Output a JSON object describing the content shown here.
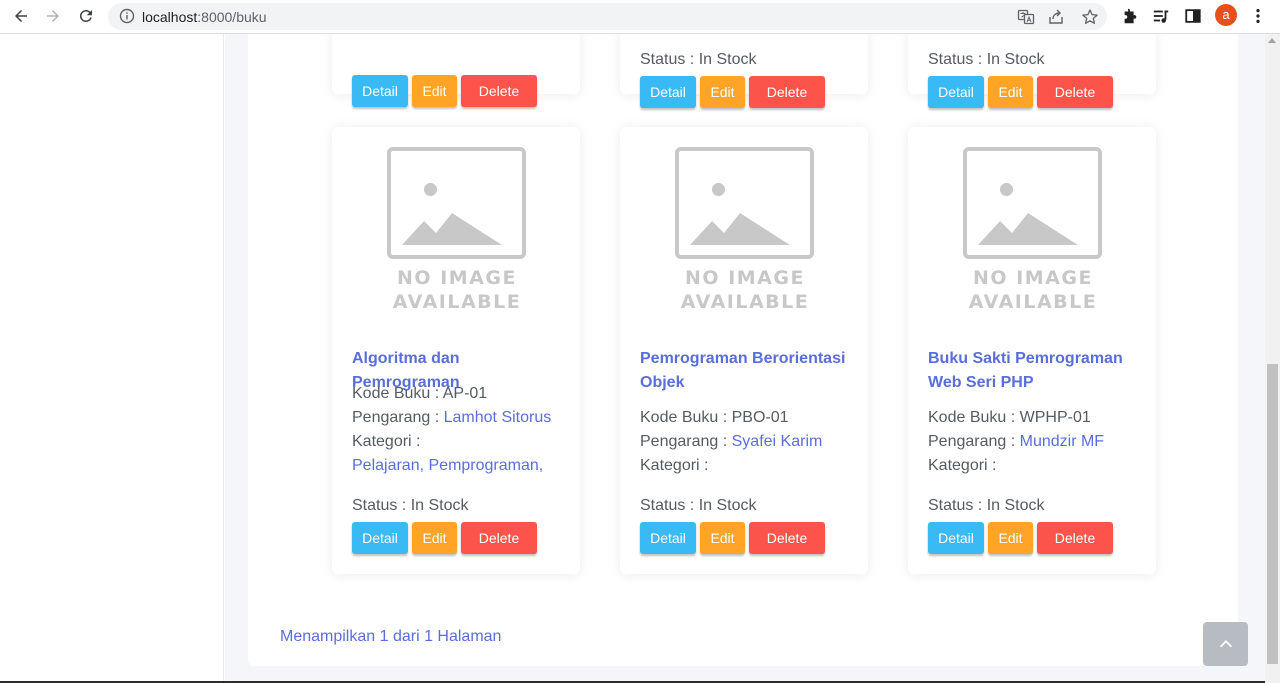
{
  "browser": {
    "url_host": "localhost",
    "url_path": ":8000/buku",
    "avatar_letter": "a"
  },
  "buttons": {
    "detail": "Detail",
    "edit": "Edit",
    "delete": "Delete"
  },
  "labels": {
    "kode": "Kode Buku : ",
    "pengarang": "Pengarang : ",
    "kategori": "Kategori : ",
    "status": "Status : In Stock"
  },
  "placeholder_image": {
    "line1": "NO IMAGE",
    "line2": "AVAILABLE"
  },
  "top_cards": [
    {
      "status": ""
    },
    {
      "status": "Status : In Stock"
    },
    {
      "status": "Status : In Stock"
    }
  ],
  "books": [
    {
      "title": "Algoritma dan Pemrograman",
      "kode": "AP-01",
      "pengarang": "Lamhot Sitorus",
      "kategori": "Pelajaran, Pemprograman,",
      "status": "Status : In Stock"
    },
    {
      "title": "Pemrograman Berorientasi Objek",
      "kode": "PBO-01",
      "pengarang": "Syafei Karim",
      "kategori": "",
      "status": "Status : In Stock"
    },
    {
      "title": "Buku Sakti Pemrograman Web Seri PHP",
      "kode": "WPHP-01",
      "pengarang": "Mundzir MF",
      "kategori": "",
      "status": "Status : In Stock"
    }
  ],
  "pagination": {
    "text": "Menampilkan 1 dari 1 Halaman"
  },
  "colors": {
    "link": "#5a6edb",
    "detail": "#3abaf4",
    "edit": "#ffa426",
    "delete": "#fc544b"
  }
}
